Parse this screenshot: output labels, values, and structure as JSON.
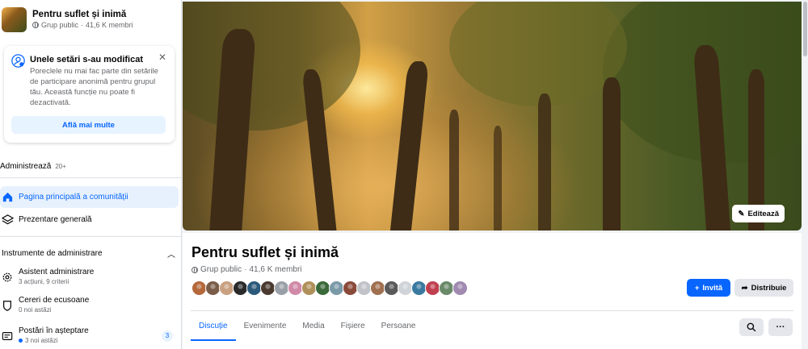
{
  "sidebar": {
    "group_name": "Pentru suflet și inimă",
    "group_privacy": "Grup public",
    "group_members": "41,6 K membri",
    "notice": {
      "title": "Unele setări s-au modificat",
      "body": "Poreclele nu mai fac parte din setările de participare anonimă pentru grupul tău. Această funcție nu poate fi dezactivată.",
      "button": "Află mai multe"
    },
    "admin_label": "Administrează",
    "admin_count": "20+",
    "nav": [
      {
        "label": "Pagina principală a comunității",
        "icon": "home-icon"
      },
      {
        "label": "Prezentare generală",
        "icon": "layers-icon"
      }
    ],
    "tools_header": "Instrumente de administrare",
    "tools": [
      {
        "title": "Asistent administrare",
        "sub": "3 acțiuni, 9 criterii",
        "icon": "gear-icon"
      },
      {
        "title": "Cereri de ecusoane",
        "sub": "0 noi astăzi",
        "icon": "shield-icon"
      },
      {
        "title": "Postări în așteptare",
        "sub": "3 noi astăzi",
        "icon": "posts-icon",
        "badge": "3"
      }
    ]
  },
  "cover": {
    "edit_label": "Editează"
  },
  "group": {
    "title": "Pentru suflet și inimă",
    "privacy": "Grup public",
    "separator": "·",
    "members": "41,6 K membri",
    "invite_label": "Invită",
    "share_label": "Distribuie"
  },
  "tabs": [
    "Discuție",
    "Evenimente",
    "Media",
    "Fișiere",
    "Persoane"
  ],
  "more_label": "···",
  "colors": {
    "accent": "#0866ff",
    "accent_light": "#e7f3ff",
    "text_secondary": "#65676b"
  },
  "avatar_colors": [
    "#b5683a",
    "#7a5c48",
    "#c9a080",
    "#2a2a2a",
    "#2c5a7a",
    "#4a3a30",
    "#9aa0a8",
    "#d08aa8",
    "#b0905a",
    "#3a6a3a",
    "#7a9aa8",
    "#8a4a3a",
    "#c0c4c8",
    "#a07050",
    "#5a5a5a",
    "#d0d4d8",
    "#3a7aa0",
    "#c04050",
    "#6a8a6a",
    "#a08ab0"
  ]
}
